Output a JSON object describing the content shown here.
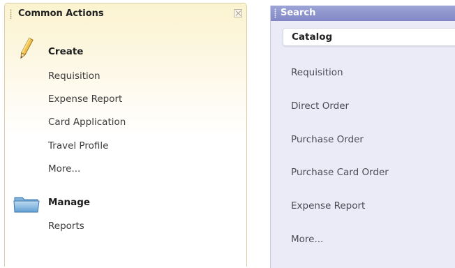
{
  "common_actions": {
    "title": "Common Actions",
    "close_icon": "close-box-icon",
    "create": {
      "icon": "pencil-icon",
      "title": "Create",
      "links": [
        "Requisition",
        "Expense Report",
        "Card Application",
        "Travel Profile",
        "More..."
      ]
    },
    "manage": {
      "icon": "folder-icon",
      "title": "Manage",
      "links": [
        "Reports"
      ]
    },
    "colors": {
      "header_bg": "#fbf3cf",
      "border": "#d8cfa8"
    }
  },
  "search": {
    "title": "Search",
    "selected_tab": "Catalog",
    "items": [
      "Requisition",
      "Direct Order",
      "Purchase Order",
      "Purchase Card Order",
      "Expense Report",
      "More..."
    ],
    "colors": {
      "header_bg": "#8188c5",
      "panel_bg": "#eaebf6"
    }
  }
}
